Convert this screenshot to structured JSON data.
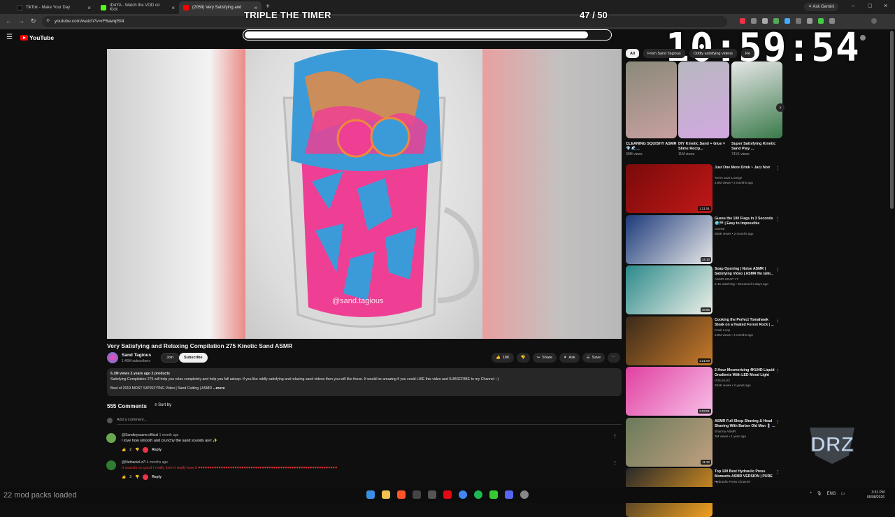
{
  "browser": {
    "tabs": [
      {
        "label": "TikTok - Make Your Day",
        "color": "#1a1a1a"
      },
      {
        "label": "ID4YA - Watch the VOD on Kick",
        "color": "#53fc18"
      },
      {
        "label": "(2059) Very Satisfying and",
        "color": "#ff0000"
      }
    ],
    "url": "youtube.com/watch?v=rF6awqlSt4",
    "ask_gemini": "Ask Gemini"
  },
  "overlay": {
    "timer_title": "TRIPLE THE TIMER",
    "count": "47 / 50",
    "progress": 0.94,
    "clock": "10:59:54"
  },
  "youtube": {
    "logo_text": "YouTube",
    "video": {
      "title": "Very Satisfying and Relaxing Compilation 275 Kinetic Sand ASMR",
      "watermark": "@sand.tagious",
      "channel": "Sand Tagious",
      "subs": "1.46M subscribers",
      "join": "Join",
      "subscribe": "Subscribe",
      "likes": "18K",
      "share": "Share",
      "ask": "Ask",
      "save": "Save"
    },
    "description": {
      "meta": "6.1M views  3 years ago  2 products",
      "line1": "Satisfying Compilation 275 will help you relax completely and help you fall asleep. If you like oddly satisfying and relaxing sand videos then you will like these. It would be amazing if you could LIKE this video and SUBSCRIBE to my Channel :-)",
      "line2": "Best of 2019 MOST SATISFYING Video | Sand Cutting | ASMR",
      "more": "...more"
    },
    "comments": {
      "count": "555 Comments",
      "sort": "Sort by",
      "add_placeholder": "Add a comment...",
      "items": [
        {
          "author": "@Sandtoysasmr.official",
          "time": "1 month ago",
          "text": "I love how smooth and crunchy the sand sounds are! ✨",
          "likes": "2",
          "reply": "Reply",
          "avatar_color": "#6aa84f"
        },
        {
          "author": "@Nathaniel-z7l",
          "time": "4 months ago",
          "text": "It sounds so good I really love it really love it ♥♥♥♥♥♥♥♥♥♥♥♥♥♥♥♥♥♥♥♥♥♥♥♥♥♥♥♥♥♥♥♥♥♥♥♥♥♥♥♥♥♥♥♥♥♥♥♥♥♥♥♥♥♥♥♥♥♥♥♥♥",
          "likes": "3",
          "reply": "Reply",
          "avatar_color": "#2e7d32"
        }
      ]
    },
    "sidebar": {
      "chips": [
        "All",
        "From Sand Tagious",
        "Oddly satisfying videos",
        "Re"
      ],
      "shorts": [
        {
          "title": "CLEANING SQUISHY ASMR 💎 🌊...",
          "views": "39M views",
          "colors": [
            "#8a8a7a",
            "#c7a0a0"
          ]
        },
        {
          "title": "DIY Kinetic Sand + Glue = Slime Recip...",
          "views": "11M views",
          "colors": [
            "#b8b8c0",
            "#d2a8e0"
          ]
        },
        {
          "title": "Super Satisfying Kinetic Sand Play ...",
          "views": "741K views",
          "colors": [
            "#e7e7e7",
            "#3a7a4a"
          ]
        }
      ],
      "recs": [
        {
          "title": "Just One More Drink ~ Jazz Noir",
          "channel": "Tom's Jazz Lounge",
          "views": "2.8M views • 2 months ago",
          "duration": "1:21:51",
          "colors": [
            "#7a0a0a",
            "#c01818"
          ]
        },
        {
          "title": "Guess the 100 Flags in 3 Seconds 🌍🏁 | Easy to Impossible",
          "channel": "Guessr",
          "views": "308K views • 2 months ago",
          "duration": "14:10",
          "colors": [
            "#1c3a7a",
            "#e8e8e8"
          ]
        },
        {
          "title": "Soap Opening | Noise ASMR | Satisfying Video | ASMR No talki...",
          "channel": "ASMR SOAP YT",
          "views": "2.1K watching • Streamed 3 days ago",
          "duration": "18:55",
          "colors": [
            "#2a8a8a",
            "#f0f0e8"
          ]
        },
        {
          "title": "Cooking the Perfect Tomahawk Steak on a Heated Forest Rock | ...",
          "channel": "Cook Loop",
          "views": "3.8M views • 4 months ago",
          "duration": "1:21:00",
          "colors": [
            "#3a2a1a",
            "#c87a2a"
          ]
        },
        {
          "title": "2 Hour Mesmerizing 4KUHD Liquid Gradients With LED Mood Light",
          "channel": "VISUALS2",
          "views": "284K views • 2 years ago",
          "duration": "2:03:01",
          "colors": [
            "#e040a0",
            "#f8c0e8"
          ]
        },
        {
          "title": "ASMR Full Sleep Shaving & Head Shaving With Barber Old Man 💈 ...",
          "channel": "Sharma ASMR",
          "views": "3M views • 1 year ago",
          "duration": "11:32",
          "colors": [
            "#6a7a5a",
            "#c0a080"
          ]
        },
        {
          "title": "Top 100 Best Hydraulic Press Moments ASMR VERSION | PURE ...",
          "channel": "Hydraulic Press Channel",
          "views": "",
          "duration": "",
          "colors": [
            "#2a2a2a",
            "#f0a020"
          ]
        }
      ]
    }
  },
  "taskbar": {
    "mods": "22 mod packs loaded",
    "lang": "ENG",
    "time": "3:51 PM",
    "date": "05/08/2026"
  }
}
